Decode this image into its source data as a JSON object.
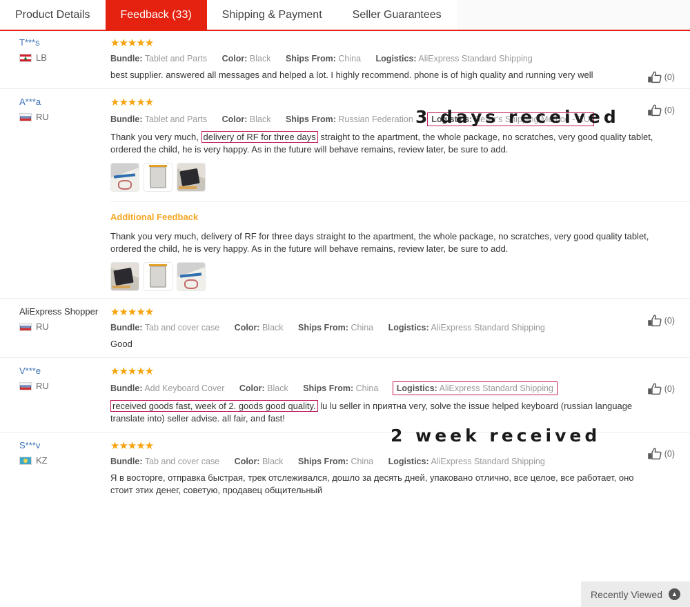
{
  "tabs": [
    {
      "label": "Product Details",
      "active": false
    },
    {
      "label": "Feedback (33)",
      "active": true
    },
    {
      "label": "Shipping & Payment",
      "active": false
    },
    {
      "label": "Seller Guarantees",
      "active": false
    }
  ],
  "labels": {
    "bundle": "Bundle:",
    "color": "Color:",
    "ships_from": "Ships From:",
    "logistics": "Logistics:",
    "additional_feedback": "Additional Feedback",
    "stars": "★★★★★",
    "helpful_count": "(0)"
  },
  "annotations": [
    {
      "text": "3 days received"
    },
    {
      "text": "2 week received"
    }
  ],
  "reviews": [
    {
      "user": "T***s",
      "country": "LB",
      "bundle": "Tablet and Parts",
      "color": "Black",
      "ships_from": "China",
      "logistics": "AliExpress Standard Shipping",
      "text": "best supplier. answered all messages and helped a lot. I highly recommend. phone is of high quality and running very well",
      "helpful": "(0)"
    },
    {
      "user": "A***a",
      "country": "RU",
      "bundle": "Tablet and Parts",
      "color": "Black",
      "ships_from": "Russian Federation",
      "logistics": "Seller's Shipping Method - RU",
      "text_pre": "Thank you very much, ",
      "text_hl": "delivery of RF for three days",
      "text_post": " straight to the apartment, the whole package, no scratches, very good quality tablet, ordered the child, he is very happy. As in the future will behave remains, review later, be sure to add.",
      "additional_text": "Thank you very much, delivery of RF for three days straight to the apartment, the whole package, no scratches, very good quality tablet, ordered the child, he is very happy. As in the future will behave remains, review later, be sure to add.",
      "helpful": "(0)"
    },
    {
      "user": "AliExpress Shopper",
      "country": "RU",
      "bundle": "Tab and cover case",
      "color": "Black",
      "ships_from": "China",
      "logistics": "AliExpress Standard Shipping",
      "text": "Good",
      "helpful": "(0)"
    },
    {
      "user": "V***e",
      "country": "RU",
      "bundle": "Add Keyboard Cover",
      "color": "Black",
      "ships_from": "China",
      "logistics": "AliExpress Standard Shipping",
      "text_hl": "received goods fast, week of 2. goods good quality.",
      "text_post": " lu lu seller in приятна very, solve the issue helped keyboard (russian language translate into) seller advise. all fair, and fast!",
      "helpful": "(0)"
    },
    {
      "user": "S***v",
      "country": "KZ",
      "bundle": "Tab and cover case",
      "color": "Black",
      "ships_from": "China",
      "logistics": "AliExpress Standard Shipping",
      "text": "Я в восторге, отправка быстрая, трек отслеживался, дошло за десять дней, упаковано отлично, все целое, все работает, оно стоит этих денег, советую, продавец общительный",
      "helpful": "(0)"
    }
  ],
  "recently_viewed": {
    "label": "Recently Viewed"
  }
}
